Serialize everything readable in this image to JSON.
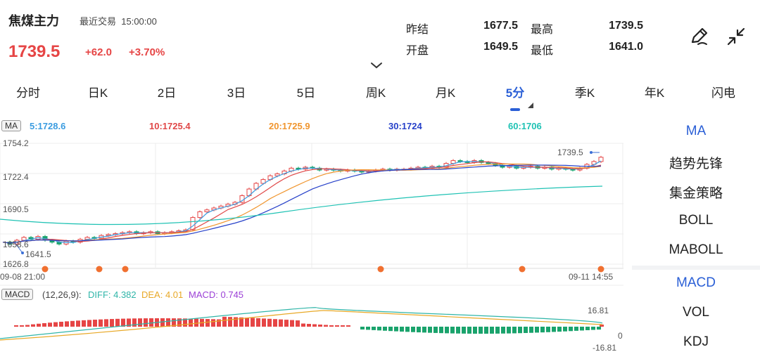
{
  "header": {
    "name": "焦煤主力",
    "status": "最近交易",
    "time": "15:00:00",
    "price": "1739.5",
    "change": "+62.0",
    "change_pct": "+3.70%",
    "stats": {
      "prev_settle_label": "昨结",
      "prev_settle": "1677.5",
      "high_label": "最高",
      "high": "1739.5",
      "open_label": "开盘",
      "open": "1649.5",
      "low_label": "最低",
      "low": "1641.0"
    }
  },
  "tabs": [
    "分时",
    "日K",
    "2日",
    "3日",
    "5日",
    "周K",
    "月K",
    "5分",
    "季K",
    "年K",
    "闪电"
  ],
  "active_tab": "5分",
  "ma_legend": {
    "tag": "MA",
    "ma5": "5:1728.6",
    "ma10": "10:1725.4",
    "ma20": "20:1725.9",
    "ma30": "30:1724",
    "ma60": "60:1706"
  },
  "axis": {
    "y_labels": [
      "1754.2",
      "1722.4",
      "1690.5",
      "1658.6",
      "1626.8"
    ],
    "x_start": "09-08 21:00",
    "x_end": "09-11 14:55",
    "high_marker": "1739.5",
    "low_marker": "1641.5"
  },
  "macd": {
    "tag": "MACD",
    "params": "(12,26,9):",
    "diff": "DIFF: 4.382",
    "dea": "DEA: 4.01",
    "macd": "MACD: 0.745",
    "y_top": "16.81",
    "y_zero": "0",
    "y_bottom": "-16.81"
  },
  "right_panel": {
    "main_items": [
      "MA",
      "趋势先锋",
      "集金策略",
      "BOLL",
      "MABOLL"
    ],
    "sub_items": [
      "MACD",
      "VOL",
      "KDJ"
    ],
    "active_main": "MA",
    "active_sub": "MACD"
  },
  "colors": {
    "up": "#e64545",
    "down": "#1aa36c",
    "accent": "#2a5fd6",
    "ma5": "#3b9ce0",
    "ma10": "#e04848",
    "ma20": "#f0952e",
    "ma30": "#2741c9",
    "ma60": "#1fc2b4",
    "macd_line_diff": "#2fb5a8",
    "macd_line_dea": "#e8a826"
  },
  "icons": [
    "pen-icon",
    "collapse-icon",
    "chevron-down-icon"
  ]
}
